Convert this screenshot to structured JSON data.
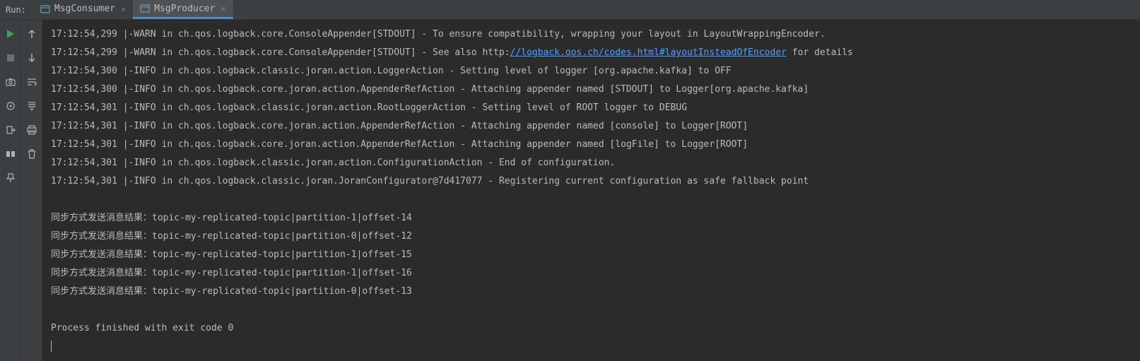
{
  "header": {
    "runLabel": "Run:",
    "tabs": [
      {
        "label": "MsgConsumer",
        "active": false
      },
      {
        "label": "MsgProducer",
        "active": true
      }
    ]
  },
  "console": {
    "lines": [
      {
        "text": "17:12:54,299 |-WARN in ch.qos.logback.core.ConsoleAppender[STDOUT] - To ensure compatibility, wrapping your layout in LayoutWrappingEncoder."
      },
      {
        "prefix": "17:12:54,299 |-WARN in ch.qos.logback.core.ConsoleAppender[STDOUT] - See also http:",
        "link": "//logback.qos.ch/codes.html#layoutInsteadOfEncoder",
        "suffix": " for details"
      },
      {
        "text": "17:12:54,300 |-INFO in ch.qos.logback.classic.joran.action.LoggerAction - Setting level of logger [org.apache.kafka] to OFF"
      },
      {
        "text": "17:12:54,300 |-INFO in ch.qos.logback.core.joran.action.AppenderRefAction - Attaching appender named [STDOUT] to Logger[org.apache.kafka]"
      },
      {
        "text": "17:12:54,301 |-INFO in ch.qos.logback.classic.joran.action.RootLoggerAction - Setting level of ROOT logger to DEBUG"
      },
      {
        "text": "17:12:54,301 |-INFO in ch.qos.logback.core.joran.action.AppenderRefAction - Attaching appender named [console] to Logger[ROOT]"
      },
      {
        "text": "17:12:54,301 |-INFO in ch.qos.logback.core.joran.action.AppenderRefAction - Attaching appender named [logFile] to Logger[ROOT]"
      },
      {
        "text": "17:12:54,301 |-INFO in ch.qos.logback.classic.joran.action.ConfigurationAction - End of configuration."
      },
      {
        "text": "17:12:54,301 |-INFO in ch.qos.logback.classic.joran.JoranConfigurator@7d417077 - Registering current configuration as safe fallback point"
      },
      {
        "text": ""
      },
      {
        "text": "同步方式发送消息结果：topic-my-replicated-topic|partition-1|offset-14"
      },
      {
        "text": "同步方式发送消息结果：topic-my-replicated-topic|partition-0|offset-12"
      },
      {
        "text": "同步方式发送消息结果：topic-my-replicated-topic|partition-1|offset-15"
      },
      {
        "text": "同步方式发送消息结果：topic-my-replicated-topic|partition-1|offset-16"
      },
      {
        "text": "同步方式发送消息结果：topic-my-replicated-topic|partition-0|offset-13"
      },
      {
        "text": ""
      },
      {
        "text": "Process finished with exit code 0"
      }
    ]
  }
}
